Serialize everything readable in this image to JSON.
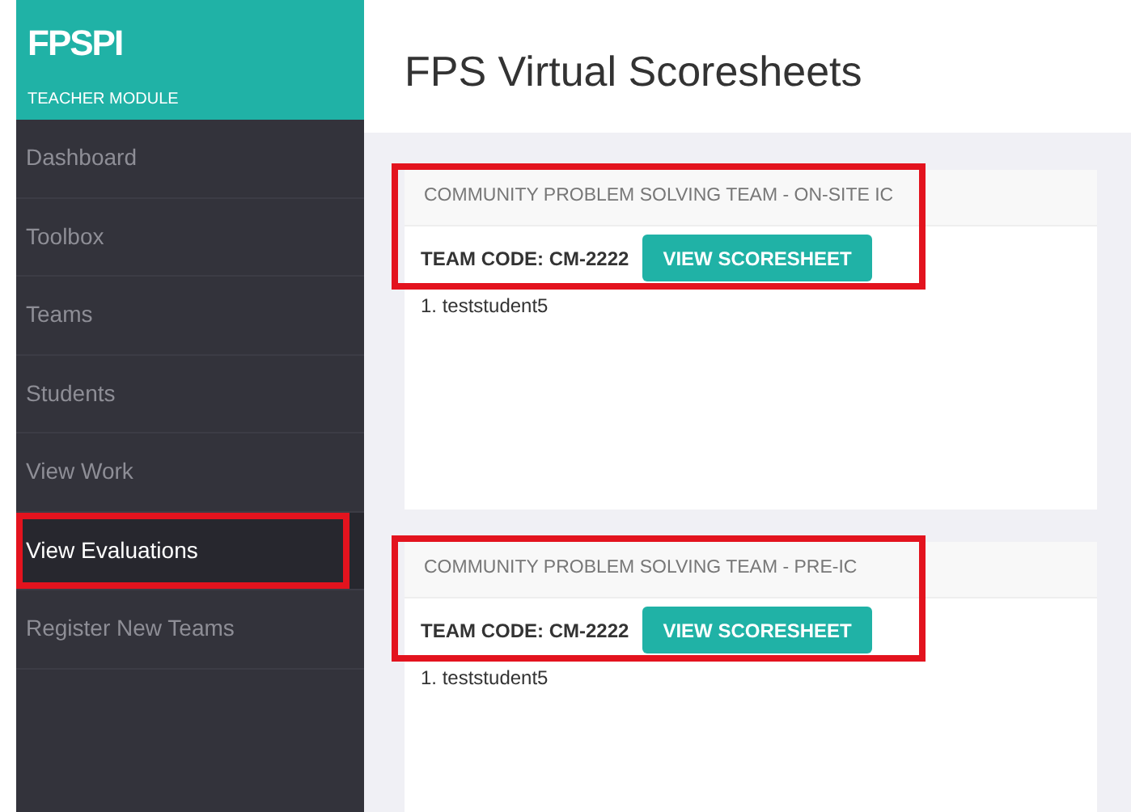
{
  "brand": {
    "title": "FPSPI",
    "subtitle": "TEACHER MODULE"
  },
  "sidebar": {
    "items": [
      {
        "label": "Dashboard",
        "selected": false,
        "highlighted": false
      },
      {
        "label": "Toolbox",
        "selected": false,
        "highlighted": false
      },
      {
        "label": "Teams",
        "selected": false,
        "highlighted": false
      },
      {
        "label": "Students",
        "selected": false,
        "highlighted": false
      },
      {
        "label": "View Work",
        "selected": false,
        "highlighted": false
      },
      {
        "label": "View Evaluations",
        "selected": true,
        "highlighted": true
      },
      {
        "label": "Register New Teams",
        "selected": false,
        "highlighted": false
      }
    ]
  },
  "page_title": "FPS Virtual Scoresheets",
  "cards": [
    {
      "title": "COMMUNITY PROBLEM SOLVING TEAM - ON-SITE IC",
      "team_code": "TEAM CODE: CM-2222",
      "button": "VIEW SCORESHEET",
      "students": [
        "1. teststudent5"
      ],
      "highlighted": true
    },
    {
      "title": "COMMUNITY PROBLEM SOLVING TEAM - PRE-IC",
      "team_code": "TEAM CODE: CM-2222",
      "button": "VIEW SCORESHEET",
      "students": [
        "1. teststudent5"
      ],
      "highlighted": true
    }
  ]
}
